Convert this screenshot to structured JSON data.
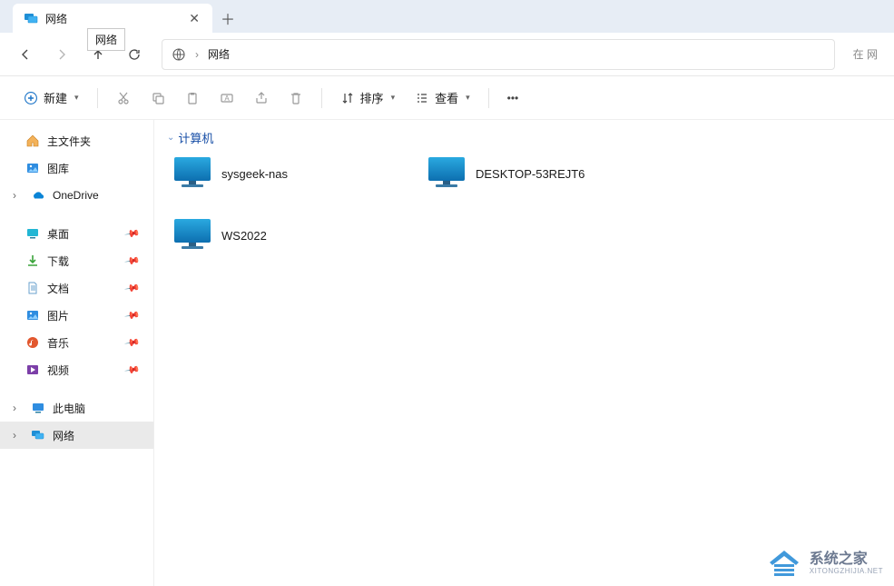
{
  "tab": {
    "title": "网络",
    "tooltip": "网络"
  },
  "address": {
    "location": "网络",
    "search_hint": "在 网"
  },
  "toolbar": {
    "new_label": "新建",
    "sort_label": "排序",
    "view_label": "查看"
  },
  "sidebar": {
    "home": "主文件夹",
    "gallery": "图库",
    "onedrive": "OneDrive",
    "desktop": "桌面",
    "downloads": "下载",
    "documents": "文档",
    "pictures": "图片",
    "music": "音乐",
    "videos": "视频",
    "thispc": "此电脑",
    "network": "网络"
  },
  "content": {
    "group_label": "计算机",
    "computers": [
      {
        "name": "sysgeek-nas"
      },
      {
        "name": "DESKTOP-53REJT6"
      },
      {
        "name": "WS2022"
      }
    ]
  },
  "watermark": {
    "title": "系统之家",
    "sub": "XITONGZHIJIA.NET"
  }
}
